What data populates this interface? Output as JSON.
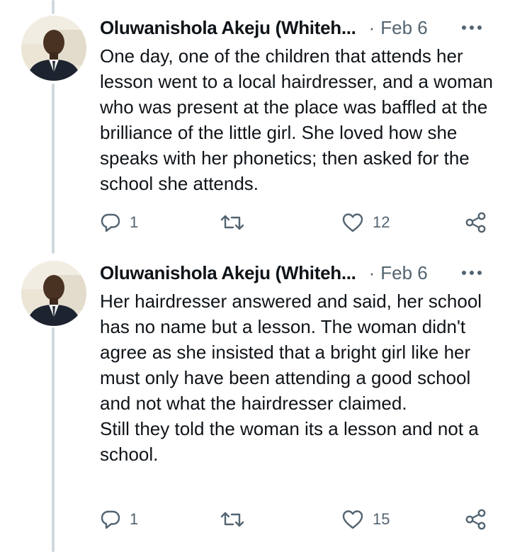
{
  "tweets": [
    {
      "author": "Oluwanishola Akeju (Whiteh...",
      "separator": "·",
      "date": "Feb 6",
      "text": "One day, one of the children that attends her lesson went to a local hairdresser, and a woman who was present at the place was baffled at the brilliance of the little girl. She loved how she speaks with her phonetics; then asked for the school she attends.",
      "replies": "1",
      "likes": "12",
      "icons": [
        "reply-icon",
        "retweet-icon",
        "like-icon",
        "share-icon",
        "more-icon"
      ]
    },
    {
      "author": "Oluwanishola Akeju (Whiteh...",
      "separator": "·",
      "date": "Feb 6",
      "text": "Her hairdresser answered and said, her school has no name but a lesson. The woman didn't agree as she insisted that a bright girl like her must only have been attending a good school and not what the hairdresser claimed.\nStill they told the woman its a lesson and not a school.",
      "replies": "1",
      "likes": "15",
      "icons": [
        "reply-icon",
        "retweet-icon",
        "like-icon",
        "share-icon",
        "more-icon"
      ]
    }
  ],
  "colors": {
    "text": "#0f1419",
    "secondary": "#536471",
    "thread_line": "#cfd9de"
  }
}
